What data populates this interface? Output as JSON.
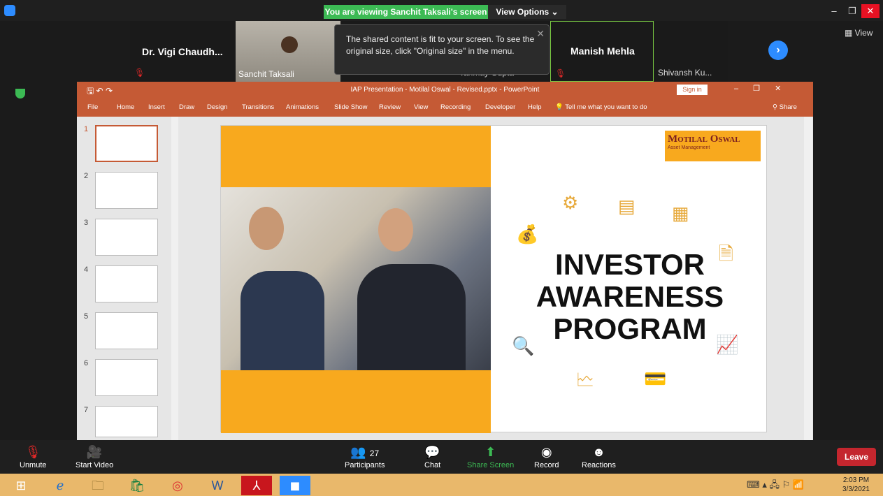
{
  "zoom": {
    "banner": "You are viewing Sanchit Taksali's screen",
    "view_options": "View Options ⌄",
    "view_button": "View",
    "tooltip": "The shared content is fit to your screen. To see the original size, click \"Original size\" in the menu.",
    "participants": [
      "Dr. Vigi Chaudh...",
      "Sanchit Taksali",
      "Tanmay Gupta",
      "Manish Mehla",
      "Shivansh Ku..."
    ],
    "bottom": {
      "unmute": "Unmute",
      "start_video": "Start Video",
      "participants_label": "Participants",
      "participant_count": "27",
      "chat": "Chat",
      "share": "Share Screen",
      "record": "Record",
      "reactions": "Reactions",
      "leave": "Leave"
    }
  },
  "ppt": {
    "title": "IAP Presentation - Motilal Oswal - Revised.pptx  -  PowerPoint",
    "signin": "Sign in",
    "share": "Share",
    "tabs": [
      "File",
      "Home",
      "Insert",
      "Draw",
      "Design",
      "Transitions",
      "Animations",
      "Slide Show",
      "Review",
      "View",
      "Recording",
      "Developer",
      "Help"
    ],
    "tell": "Tell me what you want to do",
    "thumbs": [
      "1",
      "2",
      "3",
      "4",
      "5",
      "6",
      "7"
    ],
    "slide": {
      "logo_name": "Motilal Oswal",
      "logo_sub": "Asset Management",
      "title_lines": [
        "INVESTOR",
        "AWARENESS",
        "PROGRAM"
      ]
    }
  },
  "clock": {
    "time": "2:03 PM",
    "date": "3/3/2021"
  },
  "colors": {
    "ppt": "#c55a35",
    "accent": "#f8a91e",
    "zoom_green": "#3cba54"
  }
}
